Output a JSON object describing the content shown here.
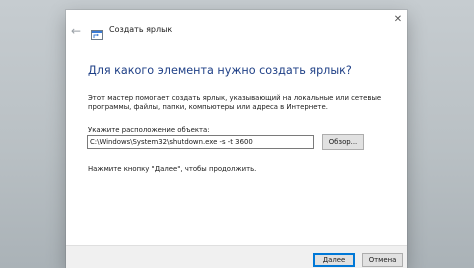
{
  "window": {
    "title": "Создать ярлык",
    "back_icon": "back-arrow-icon",
    "app_icon": "shortcut-wizard-icon",
    "close_icon": "close-icon",
    "close_glyph": "✕",
    "back_glyph": "←"
  },
  "wizard": {
    "heading": "Для какого элемента нужно создать ярлык?",
    "description": "Этот мастер помогает создать ярлык, указывающий на локальные или сетевые программы, файлы, папки, компьютеры или адреса в Интернете.",
    "location_label": "Укажите расположение объекта:",
    "location_value": "C:\\Windows\\System32\\shutdown.exe -s -t 3600",
    "browse_label": "Обзор...",
    "hint": "Нажмите кнопку \"Далее\", чтобы продолжить."
  },
  "footer": {
    "next_label": "Далее",
    "cancel_label": "Отмена"
  },
  "colors": {
    "heading": "#1e3f86",
    "accent": "#0078d7",
    "footer_bg": "#f0f0f0",
    "button_bg": "#e1e1e1"
  }
}
